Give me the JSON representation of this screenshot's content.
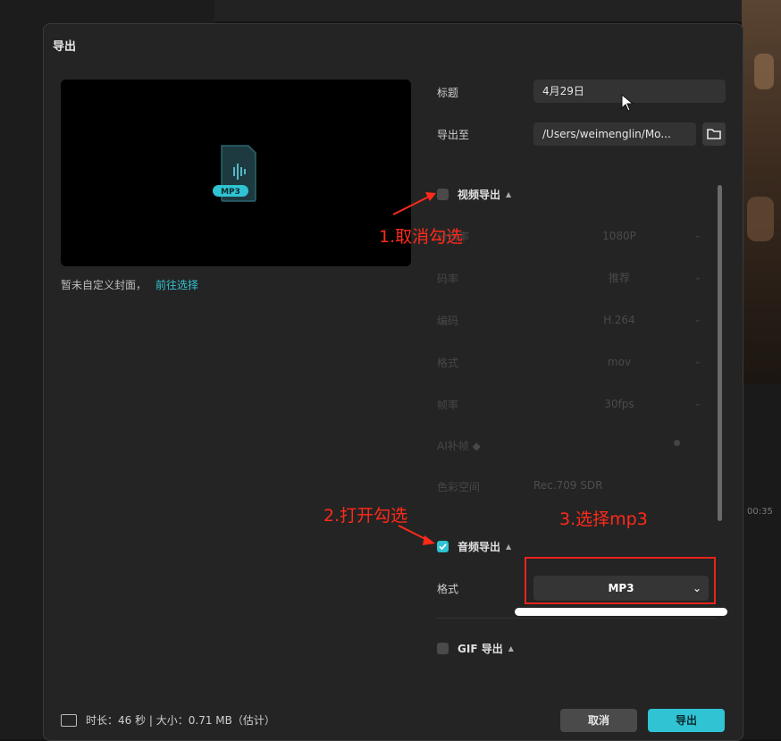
{
  "dialog": {
    "title": "导出",
    "cover_note": "暂未自定义封面，",
    "cover_link": "前往选择",
    "file_badge": "MP3"
  },
  "fields": {
    "title_label": "标题",
    "title_value": "4月29日",
    "export_to_label": "导出至",
    "export_to_value": "/Users/weimenglin/Mo..."
  },
  "video_section": {
    "label": "视频导出",
    "checked": false,
    "rows": [
      {
        "label": "分辨率",
        "value": "1080P"
      },
      {
        "label": "码率",
        "value": "推荐"
      },
      {
        "label": "编码",
        "value": "H.264"
      },
      {
        "label": "格式",
        "value": "mov"
      },
      {
        "label": "帧率",
        "value": "30fps"
      }
    ],
    "ai_label": "AI补帧",
    "color_label": "色彩空间",
    "color_value": "Rec.709 SDR"
  },
  "audio_section": {
    "label": "音频导出",
    "checked": true,
    "format_label": "格式",
    "format_value": "MP3"
  },
  "gif_section": {
    "label": "GIF 导出",
    "checked": false
  },
  "footer": {
    "info": "时长：46 秒 | 大小：0.71 MB（估计）",
    "cancel": "取消",
    "export": "导出"
  },
  "background": {
    "timecode": "00:35"
  },
  "annotations": {
    "step1": "1.取消勾选",
    "step2": "2.打开勾选",
    "step3": "3.选择mp3"
  },
  "colors": {
    "accent": "#2fc3d3",
    "annotation_red": "#ff2a1a"
  }
}
